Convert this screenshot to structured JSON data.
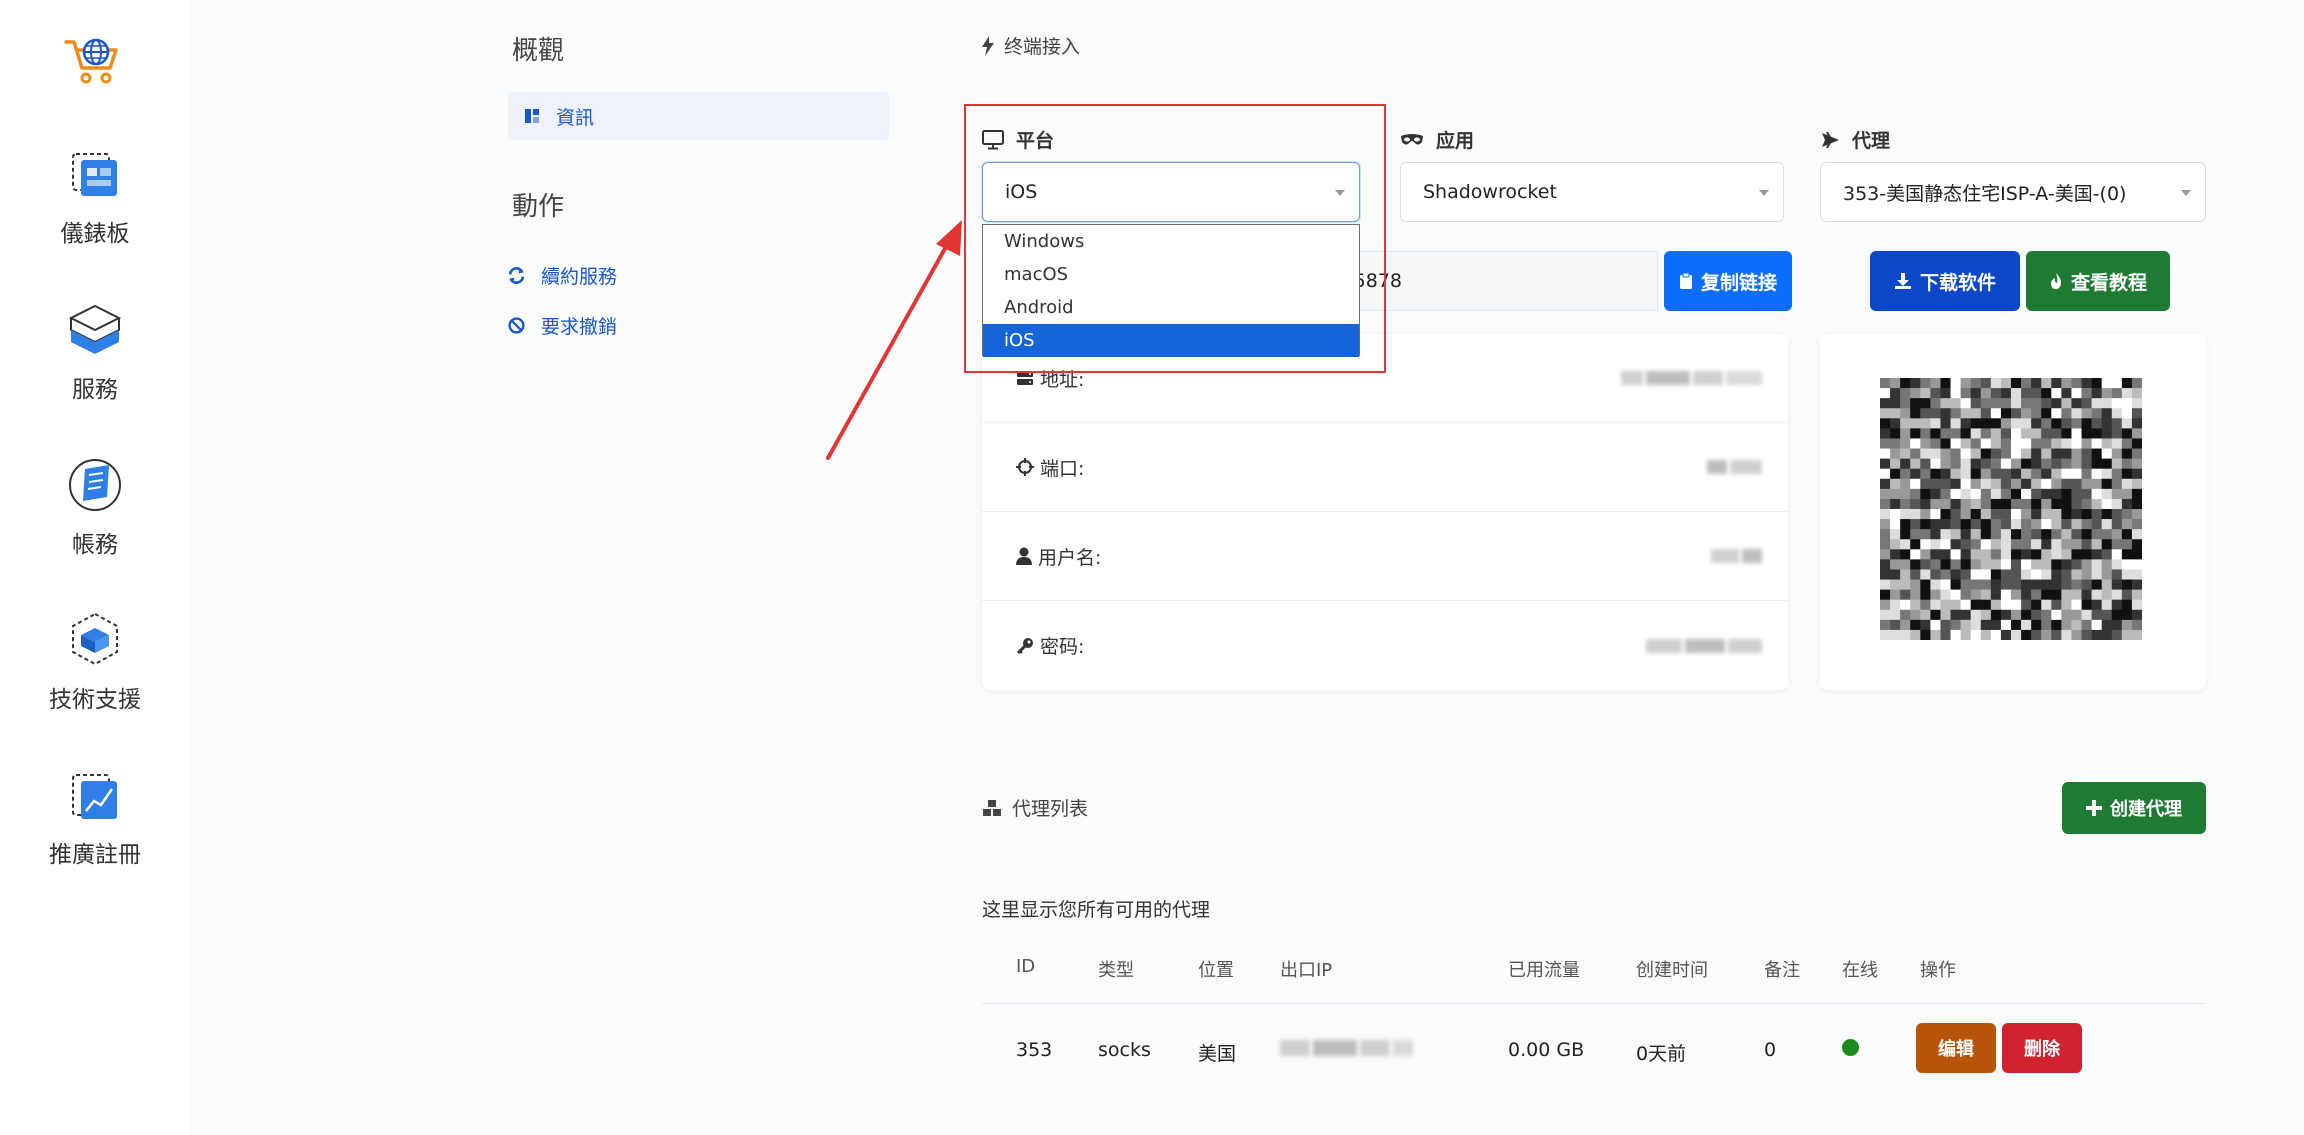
{
  "nav": {
    "items": [
      {
        "label": "儀錶板"
      },
      {
        "label": "服務"
      },
      {
        "label": "帳務"
      },
      {
        "label": "技術支援"
      },
      {
        "label": "推廣註冊"
      }
    ]
  },
  "submenu": {
    "overview_title": "概觀",
    "info_label": "資訊",
    "actions_title": "動作",
    "renew_label": "續約服務",
    "cancel_label": "要求撤銷"
  },
  "terminal": {
    "title": "终端接入",
    "platform_label": "平台",
    "platform_value": "iOS",
    "platform_options": [
      "Windows",
      "macOS",
      "Android",
      "iOS"
    ],
    "app_label": "应用",
    "app_value": "Shadowrocket",
    "proxy_label": "代理",
    "proxy_value": "353-美国静态住宅ISP-A-美国-(0)",
    "link_value": "03:15878",
    "copy_link_label": "复制链接",
    "download_label": "下载软件",
    "tutorial_label": "查看教程"
  },
  "info": {
    "address_label": "地址:",
    "port_label": "端口:",
    "username_label": "用户名:",
    "password_label": "密码:"
  },
  "proxy_list": {
    "title": "代理列表",
    "create_label": "创建代理",
    "description": "这里显示您所有可用的代理",
    "headers": [
      "ID",
      "类型",
      "位置",
      "出口IP",
      "已用流量",
      "创建时间",
      "备注",
      "在线",
      "操作"
    ],
    "row": {
      "id": "353",
      "type": "socks",
      "location": "美国",
      "traffic": "0.00 GB",
      "created": "0天前",
      "note": "0",
      "edit_label": "编辑",
      "delete_label": "删除"
    }
  },
  "colors": {
    "accent_blue": "#0d6efd",
    "link_blue": "#1a57c9",
    "green": "#1f7a34",
    "orange": "#b85408",
    "red": "#d0222f",
    "annotation_red": "#e23636"
  }
}
